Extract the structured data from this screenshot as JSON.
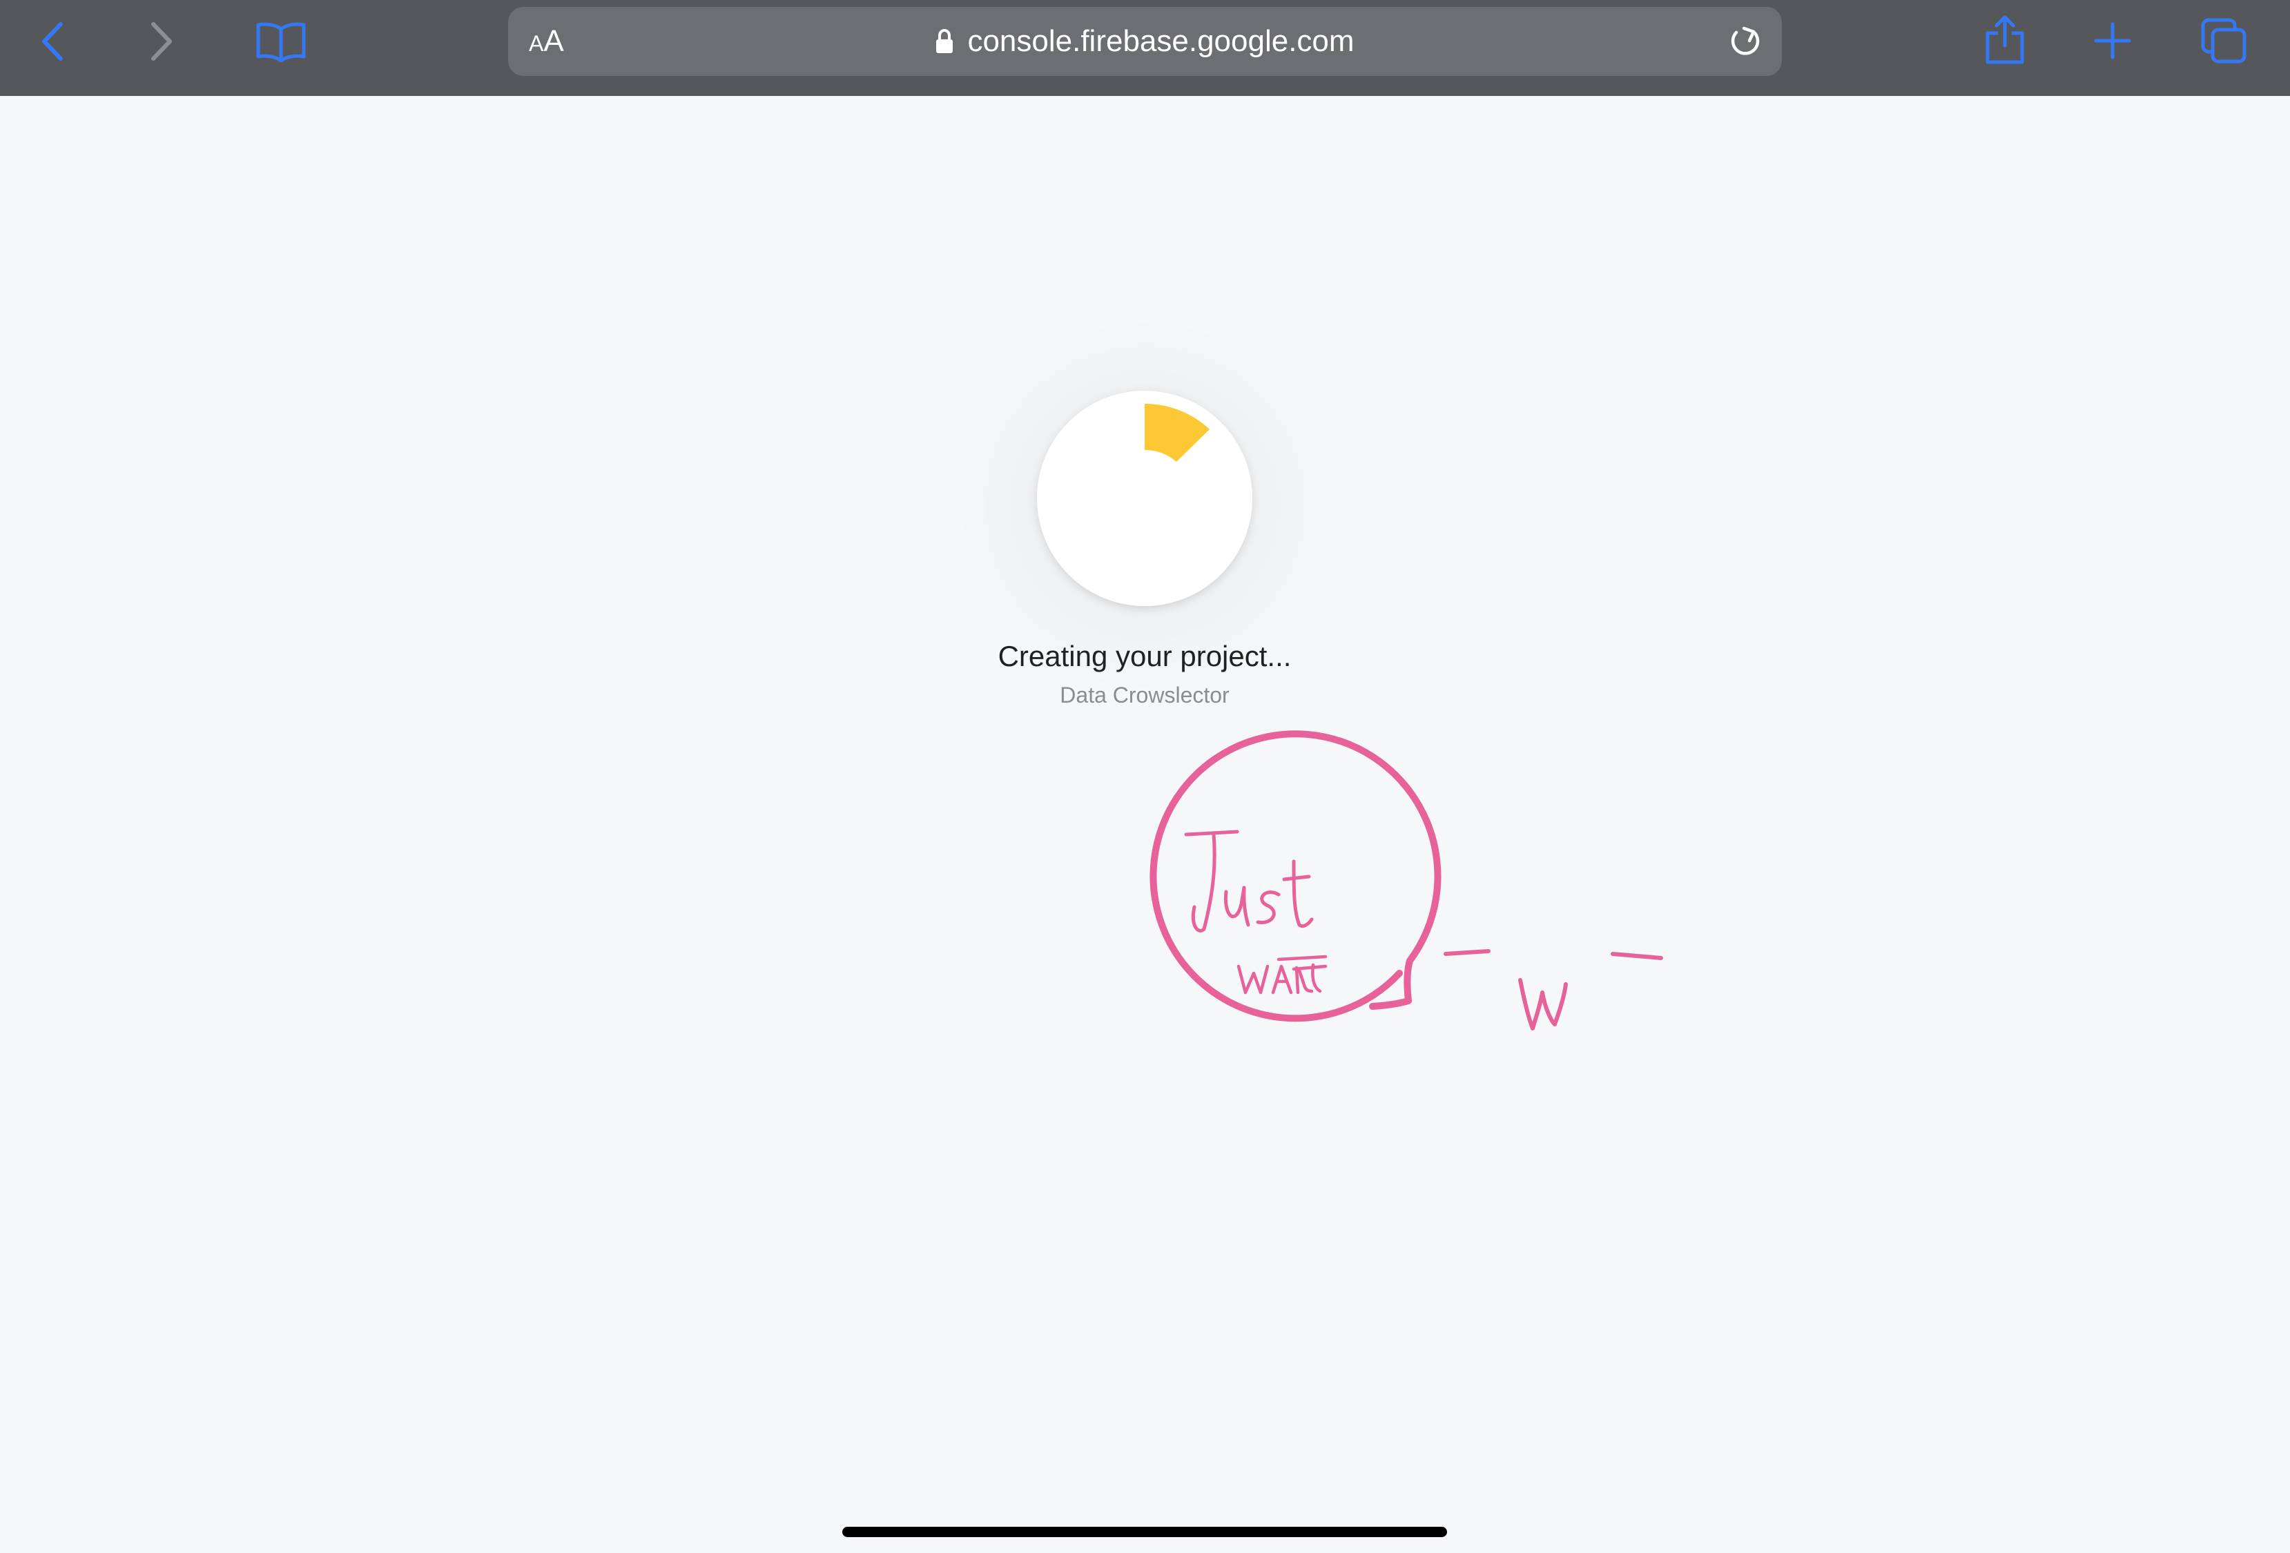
{
  "browser": {
    "text_size_button": {
      "small": "A",
      "large": "A"
    },
    "url": "console.firebase.google.com"
  },
  "loader": {
    "title": "Creating your project...",
    "project_name": "Data Crowslector"
  },
  "annotation": {
    "bubble_text_line1": "Just",
    "bubble_text_line2": "WAIT",
    "face_text": "-w-"
  },
  "colors": {
    "toolbar": "#56575b",
    "address_bar": "#6d6e72",
    "accent_blue": "#3478f6",
    "spinner_yellow": "#fcc934",
    "annotation_pink": "#e8629a",
    "page_background": "#f6f7f9"
  },
  "icons": {
    "back": "chevron-left-icon",
    "forward": "chevron-right-icon",
    "bookmarks": "book-icon",
    "lock": "lock-icon",
    "reload": "reload-icon",
    "share": "share-icon",
    "new_tab": "plus-icon",
    "tabs": "tabs-icon"
  }
}
